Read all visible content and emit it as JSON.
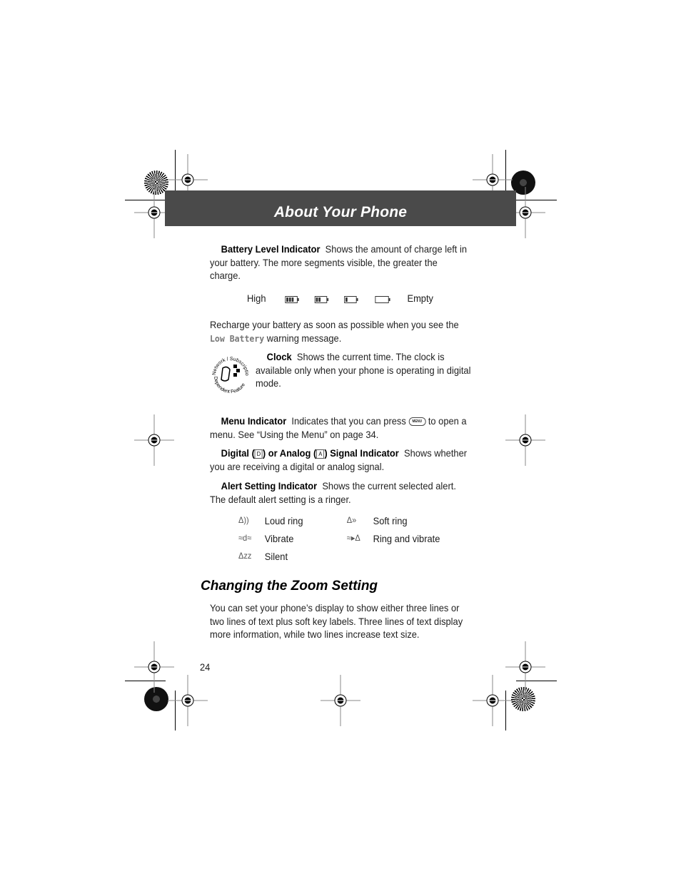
{
  "header": {
    "title": "About Your Phone"
  },
  "battery": {
    "term": "Battery Level Indicator",
    "description": "Shows the amount of charge left in your battery. The more segments visible, the greater the charge.",
    "scale_high_label": "High",
    "scale_empty_label": "Empty",
    "levels": [
      3,
      2,
      1,
      0
    ],
    "recharge_text_before": "Recharge your battery as soon as possible when you see the",
    "recharge_message": "Low Battery",
    "recharge_text_after": "warning message."
  },
  "clock": {
    "badge_top": "Network / Subscription",
    "badge_bottom": "Dependent Feature",
    "term": "Clock",
    "description": "Shows the current time. The clock is available only when your phone is operating in digital mode."
  },
  "menu_indicator": {
    "term": "Menu Indicator",
    "description_before": "Indicates that you can press",
    "key_label": "MENU",
    "description_after": "to open a menu. See “Using the Menu” on page 34."
  },
  "signal_indicator": {
    "term_part1": "Digital (",
    "digital_glyph": "D",
    "term_part2": ") or Analog (",
    "analog_glyph": "A",
    "term_part3": ") Signal Indicator",
    "description": "Shows whether you are receiving a digital or analog signal."
  },
  "alert_indicator": {
    "term": "Alert Setting Indicator",
    "description": "Shows the current selected alert. The default alert setting is a ringer.",
    "alerts": [
      {
        "icon": "loud-ring-icon",
        "glyph": "Δ))",
        "label": "Loud ring"
      },
      {
        "icon": "soft-ring-icon",
        "glyph": "Δ»",
        "label": "Soft ring"
      },
      {
        "icon": "vibrate-icon",
        "glyph": "≈d≈",
        "label": "Vibrate"
      },
      {
        "icon": "ring-and-vibrate-icon",
        "glyph": "≈▸Δ",
        "label": "Ring and vibrate"
      },
      {
        "icon": "silent-icon",
        "glyph": "Δzᴢ",
        "label": "Silent"
      }
    ]
  },
  "zoom_section": {
    "title": "Changing the Zoom Setting",
    "body": "You can set your phone’s display to show either three lines or two lines of text plus soft key labels. Three lines of text display more information, while two lines increase text size."
  },
  "footer": {
    "page_number": "24"
  }
}
